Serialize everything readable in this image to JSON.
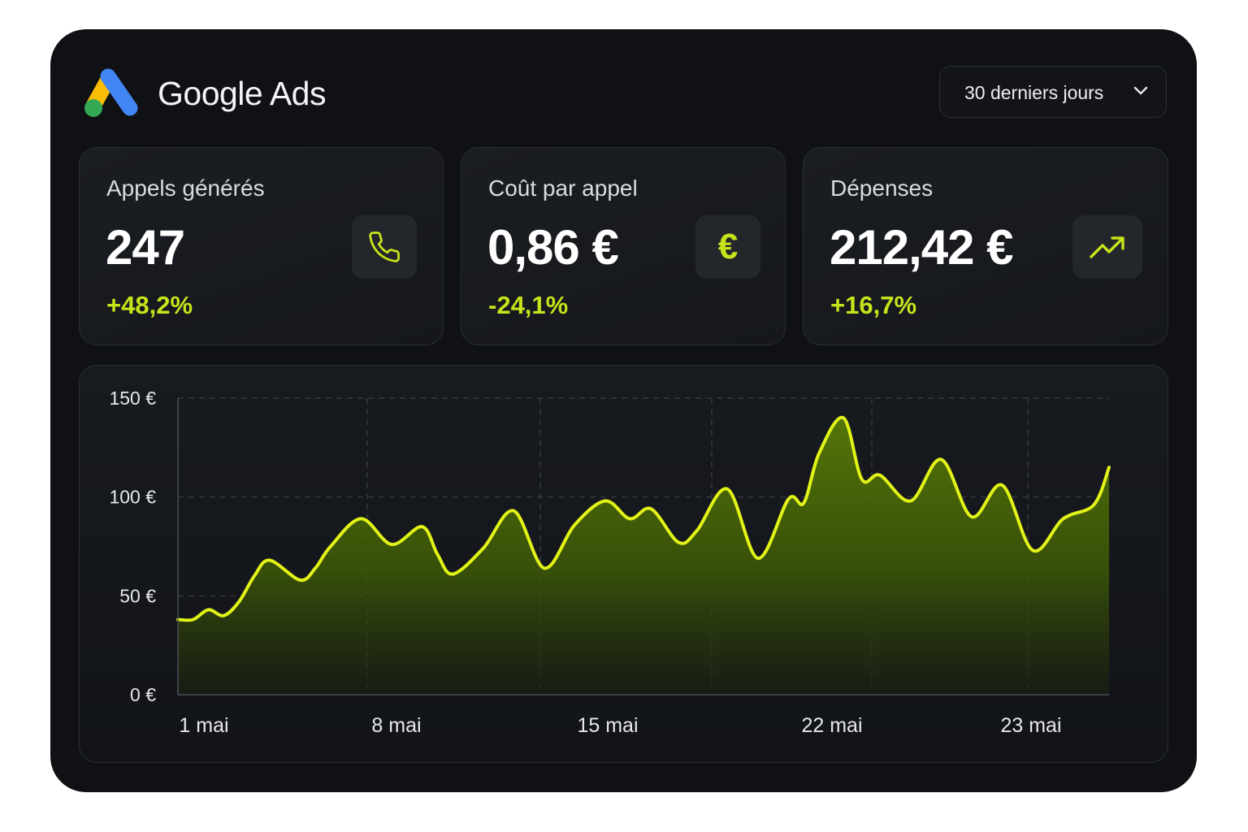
{
  "header": {
    "brand": "Google Ads",
    "logo_icon": "google-ads-logo",
    "date_range": {
      "label": "30 derniers jours",
      "icon": "chevron-down-icon"
    }
  },
  "kpis": [
    {
      "label": "Appels générés",
      "value": "247",
      "delta": "+48,2%",
      "icon": "phone-icon"
    },
    {
      "label": "Coût par appel",
      "value": "0,86 €",
      "delta": "-24,1%",
      "icon": "euro-icon",
      "glyph": "€"
    },
    {
      "label": "Dépenses",
      "value": "212,42 €",
      "delta": "+16,7%",
      "icon": "trending-up-icon"
    }
  ],
  "colors": {
    "accent": "#c7e31a",
    "line": "#e2f318",
    "background": "#0f1114",
    "card": "#181b20",
    "logo_yellow": "#fbbc04",
    "logo_blue": "#4285f4",
    "logo_green": "#34a853"
  },
  "chart_data": {
    "type": "area",
    "y_axis": {
      "ticks": [
        "0 €",
        "50 €",
        "100 €",
        "150 €"
      ],
      "tick_values": [
        0,
        50,
        100,
        150
      ],
      "ylim": [
        0,
        150
      ]
    },
    "x_axis": {
      "ticks": [
        "1 mai",
        "8 mai",
        "15 mai",
        "22 mai",
        "23 mai"
      ],
      "tick_positions": [
        0,
        7,
        14,
        21,
        28
      ]
    },
    "grid": true,
    "series": [
      {
        "x": [
          0,
          0.5,
          1,
          1.5,
          2,
          2.5,
          3,
          4,
          4.5,
          5,
          6,
          7,
          8,
          8.5,
          9,
          10,
          11,
          12,
          13,
          14,
          14.8,
          15.5,
          16.4,
          17,
          18,
          19,
          20,
          20.5,
          21,
          21.8,
          22.4,
          23,
          24,
          25,
          26,
          27,
          28,
          29,
          30,
          30.5
        ],
        "values": [
          38,
          38,
          43,
          40,
          47,
          60,
          68,
          58,
          64,
          75,
          89,
          76,
          85,
          71,
          61,
          74,
          93,
          64,
          86,
          98,
          89,
          94,
          77,
          83,
          104,
          69,
          99,
          97,
          122,
          140,
          109,
          111,
          98,
          119,
          90,
          106,
          73,
          89,
          96,
          115
        ]
      }
    ]
  }
}
